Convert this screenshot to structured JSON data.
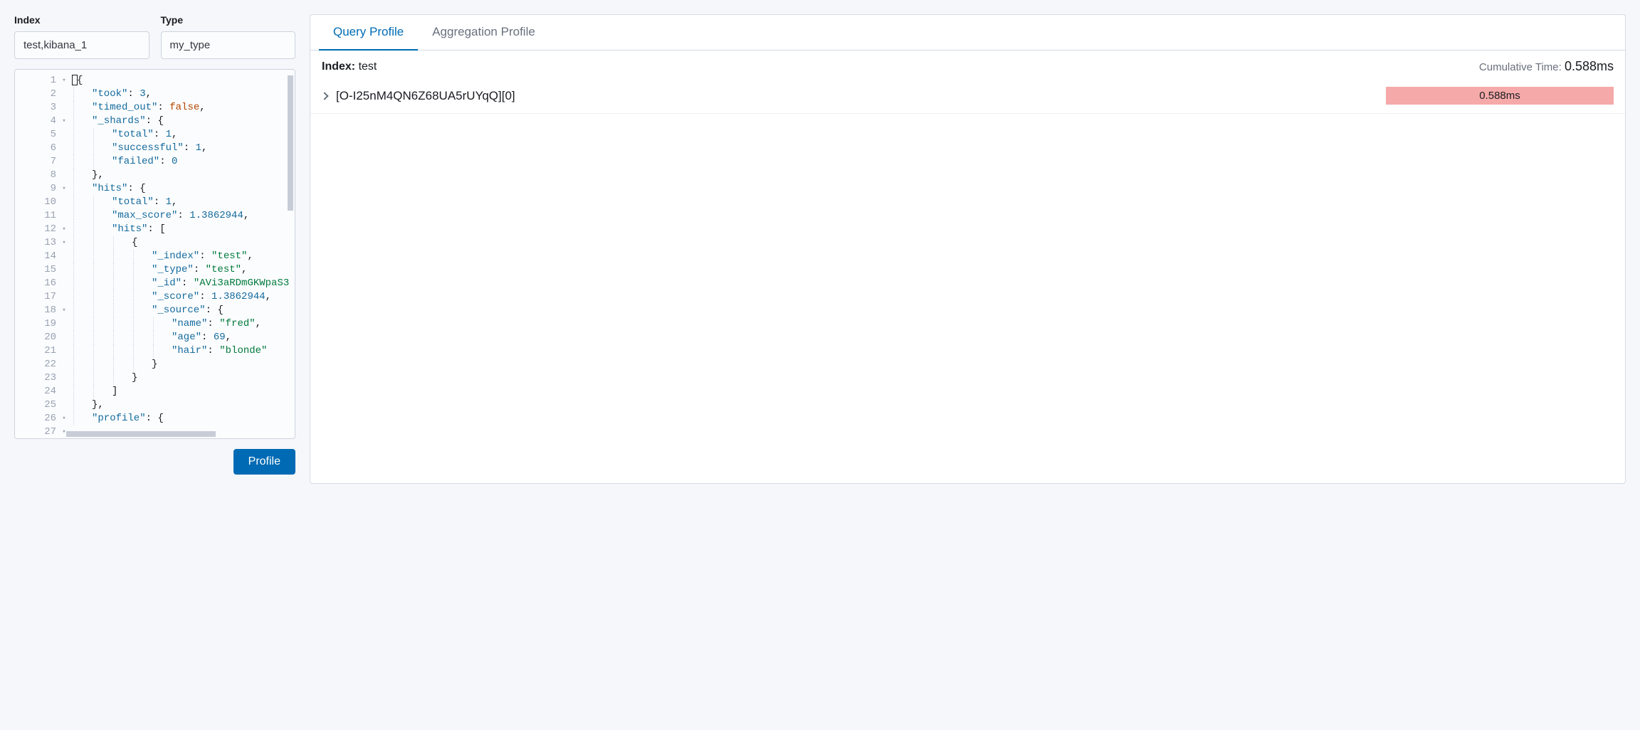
{
  "form": {
    "index_label": "Index",
    "type_label": "Type",
    "index_value": "test,kibana_1",
    "type_value": "my_type"
  },
  "editor": {
    "lines": [
      {
        "n": 1,
        "fold": true,
        "indent": 0,
        "tokens": [
          {
            "t": "brace",
            "v": "{"
          }
        ],
        "cursor": true
      },
      {
        "n": 2,
        "fold": false,
        "indent": 1,
        "tokens": [
          {
            "t": "key",
            "v": "\"took\""
          },
          {
            "t": "colon",
            "v": ": "
          },
          {
            "t": "number",
            "v": "3"
          },
          {
            "t": "comma",
            "v": ","
          }
        ]
      },
      {
        "n": 3,
        "fold": false,
        "indent": 1,
        "tokens": [
          {
            "t": "key",
            "v": "\"timed_out\""
          },
          {
            "t": "colon",
            "v": ": "
          },
          {
            "t": "bool",
            "v": "false"
          },
          {
            "t": "comma",
            "v": ","
          }
        ]
      },
      {
        "n": 4,
        "fold": true,
        "indent": 1,
        "tokens": [
          {
            "t": "key",
            "v": "\"_shards\""
          },
          {
            "t": "colon",
            "v": ": "
          },
          {
            "t": "brace",
            "v": "{"
          }
        ]
      },
      {
        "n": 5,
        "fold": false,
        "indent": 2,
        "tokens": [
          {
            "t": "key",
            "v": "\"total\""
          },
          {
            "t": "colon",
            "v": ": "
          },
          {
            "t": "number",
            "v": "1"
          },
          {
            "t": "comma",
            "v": ","
          }
        ]
      },
      {
        "n": 6,
        "fold": false,
        "indent": 2,
        "tokens": [
          {
            "t": "key",
            "v": "\"successful\""
          },
          {
            "t": "colon",
            "v": ": "
          },
          {
            "t": "number",
            "v": "1"
          },
          {
            "t": "comma",
            "v": ","
          }
        ]
      },
      {
        "n": 7,
        "fold": false,
        "indent": 2,
        "tokens": [
          {
            "t": "key",
            "v": "\"failed\""
          },
          {
            "t": "colon",
            "v": ": "
          },
          {
            "t": "number",
            "v": "0"
          }
        ]
      },
      {
        "n": 8,
        "fold": false,
        "indent": 1,
        "tokens": [
          {
            "t": "brace",
            "v": "}"
          },
          {
            "t": "comma",
            "v": ","
          }
        ]
      },
      {
        "n": 9,
        "fold": true,
        "indent": 1,
        "tokens": [
          {
            "t": "key",
            "v": "\"hits\""
          },
          {
            "t": "colon",
            "v": ": "
          },
          {
            "t": "brace",
            "v": "{"
          }
        ]
      },
      {
        "n": 10,
        "fold": false,
        "indent": 2,
        "tokens": [
          {
            "t": "key",
            "v": "\"total\""
          },
          {
            "t": "colon",
            "v": ": "
          },
          {
            "t": "number",
            "v": "1"
          },
          {
            "t": "comma",
            "v": ","
          }
        ]
      },
      {
        "n": 11,
        "fold": false,
        "indent": 2,
        "tokens": [
          {
            "t": "key",
            "v": "\"max_score\""
          },
          {
            "t": "colon",
            "v": ": "
          },
          {
            "t": "number",
            "v": "1.3862944"
          },
          {
            "t": "comma",
            "v": ","
          }
        ]
      },
      {
        "n": 12,
        "fold": true,
        "indent": 2,
        "tokens": [
          {
            "t": "key",
            "v": "\"hits\""
          },
          {
            "t": "colon",
            "v": ": "
          },
          {
            "t": "bracket",
            "v": "["
          }
        ]
      },
      {
        "n": 13,
        "fold": true,
        "indent": 3,
        "tokens": [
          {
            "t": "brace",
            "v": "{"
          }
        ]
      },
      {
        "n": 14,
        "fold": false,
        "indent": 4,
        "tokens": [
          {
            "t": "key",
            "v": "\"_index\""
          },
          {
            "t": "colon",
            "v": ": "
          },
          {
            "t": "string",
            "v": "\"test\""
          },
          {
            "t": "comma",
            "v": ","
          }
        ]
      },
      {
        "n": 15,
        "fold": false,
        "indent": 4,
        "tokens": [
          {
            "t": "key",
            "v": "\"_type\""
          },
          {
            "t": "colon",
            "v": ": "
          },
          {
            "t": "string",
            "v": "\"test\""
          },
          {
            "t": "comma",
            "v": ","
          }
        ]
      },
      {
        "n": 16,
        "fold": false,
        "indent": 4,
        "tokens": [
          {
            "t": "key",
            "v": "\"_id\""
          },
          {
            "t": "colon",
            "v": ": "
          },
          {
            "t": "string",
            "v": "\"AVi3aRDmGKWpaS3"
          }
        ]
      },
      {
        "n": 17,
        "fold": false,
        "indent": 4,
        "tokens": [
          {
            "t": "key",
            "v": "\"_score\""
          },
          {
            "t": "colon",
            "v": ": "
          },
          {
            "t": "number",
            "v": "1.3862944"
          },
          {
            "t": "comma",
            "v": ","
          }
        ]
      },
      {
        "n": 18,
        "fold": true,
        "indent": 4,
        "tokens": [
          {
            "t": "key",
            "v": "\"_source\""
          },
          {
            "t": "colon",
            "v": ": "
          },
          {
            "t": "brace",
            "v": "{"
          }
        ]
      },
      {
        "n": 19,
        "fold": false,
        "indent": 5,
        "tokens": [
          {
            "t": "key",
            "v": "\"name\""
          },
          {
            "t": "colon",
            "v": ": "
          },
          {
            "t": "string",
            "v": "\"fred\""
          },
          {
            "t": "comma",
            "v": ","
          }
        ]
      },
      {
        "n": 20,
        "fold": false,
        "indent": 5,
        "tokens": [
          {
            "t": "key",
            "v": "\"age\""
          },
          {
            "t": "colon",
            "v": ": "
          },
          {
            "t": "number",
            "v": "69"
          },
          {
            "t": "comma",
            "v": ","
          }
        ]
      },
      {
        "n": 21,
        "fold": false,
        "indent": 5,
        "tokens": [
          {
            "t": "key",
            "v": "\"hair\""
          },
          {
            "t": "colon",
            "v": ": "
          },
          {
            "t": "string",
            "v": "\"blonde\""
          }
        ]
      },
      {
        "n": 22,
        "fold": false,
        "indent": 4,
        "tokens": [
          {
            "t": "brace",
            "v": "}"
          }
        ]
      },
      {
        "n": 23,
        "fold": false,
        "indent": 3,
        "tokens": [
          {
            "t": "brace",
            "v": "}"
          }
        ]
      },
      {
        "n": 24,
        "fold": false,
        "indent": 2,
        "tokens": [
          {
            "t": "bracket",
            "v": "]"
          }
        ]
      },
      {
        "n": 25,
        "fold": false,
        "indent": 1,
        "tokens": [
          {
            "t": "brace",
            "v": "}"
          },
          {
            "t": "comma",
            "v": ","
          }
        ]
      },
      {
        "n": 26,
        "fold": true,
        "indent": 1,
        "tokens": [
          {
            "t": "key",
            "v": "\"profile\""
          },
          {
            "t": "colon",
            "v": ": "
          },
          {
            "t": "brace",
            "v": "{"
          }
        ]
      },
      {
        "n": 27,
        "fold": true,
        "indent": 0,
        "tokens": []
      }
    ]
  },
  "buttons": {
    "profile": "Profile"
  },
  "tabs": {
    "query": "Query Profile",
    "aggregation": "Aggregation Profile"
  },
  "results": {
    "index_label": "Index:",
    "index_value": "test",
    "cumulative_label": "Cumulative Time:",
    "cumulative_value": "0.588ms",
    "shard_name": "[O-I25nM4QN6Z68UA5rUYqQ][0]",
    "shard_time": "0.588ms"
  }
}
